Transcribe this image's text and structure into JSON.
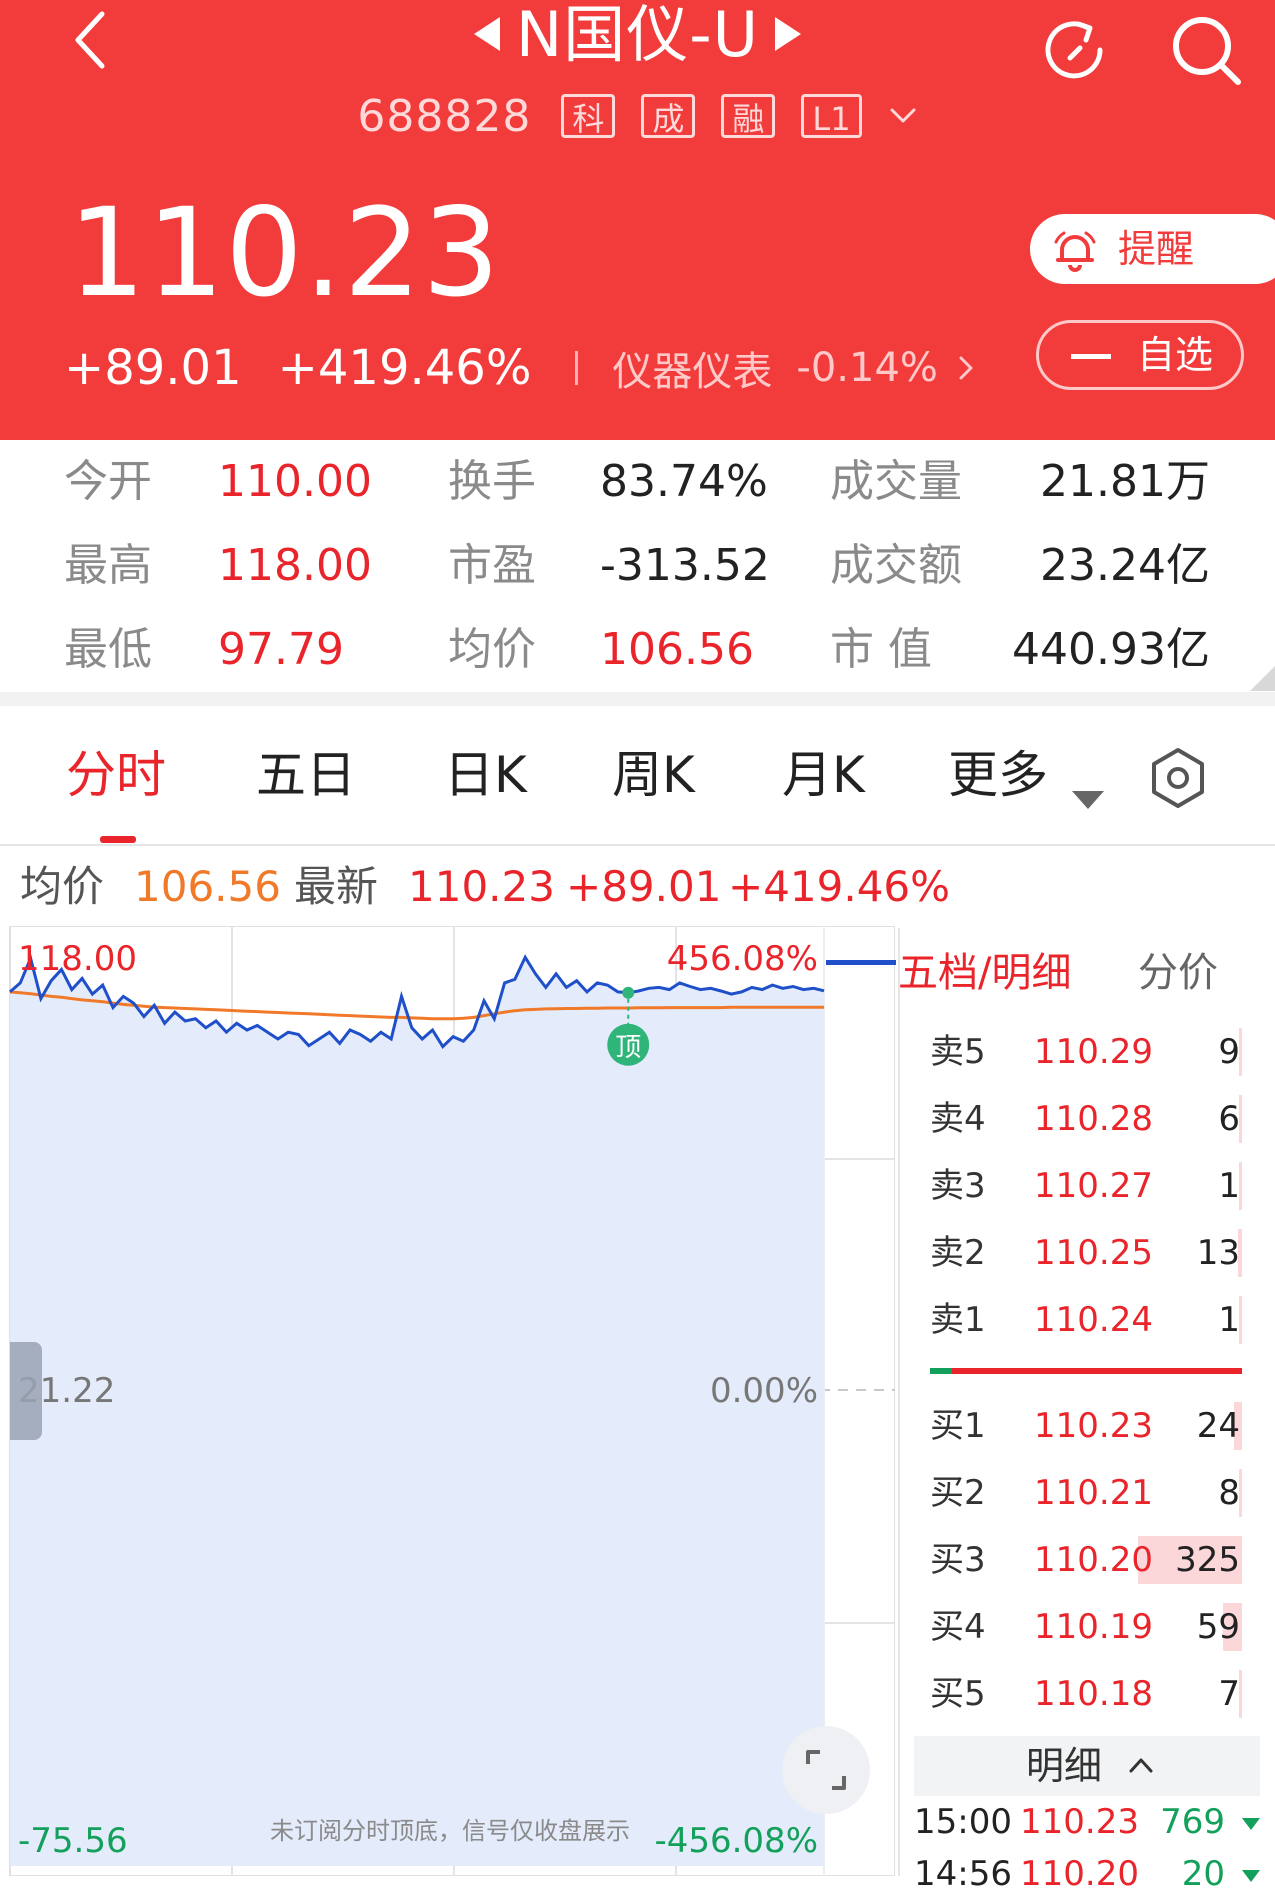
{
  "header": {
    "title": "N国仪-U",
    "code": "688828",
    "badges": [
      "科",
      "成",
      "融",
      "L1"
    ],
    "price": "110.23",
    "change": "+89.01",
    "change_pct": "+419.46%",
    "sector_name": "仪器仪表",
    "sector_change": "-0.14%",
    "alert_label": "提醒",
    "watch_label": "自选"
  },
  "stats": [
    [
      {
        "label": "今开",
        "value": "110.00"
      },
      {
        "label": "换手",
        "value": "83.74%"
      },
      {
        "label": "成交量",
        "value": "21.81万"
      }
    ],
    [
      {
        "label": "最高",
        "value": "118.00"
      },
      {
        "label": "市盈",
        "value": "-313.52"
      },
      {
        "label": "成交额",
        "value": "23.24亿"
      }
    ],
    [
      {
        "label": "最低",
        "value": "97.79"
      },
      {
        "label": "均价",
        "value": "106.56"
      },
      {
        "label": "市 值",
        "value": "440.93亿"
      }
    ]
  ],
  "tabs": [
    "分时",
    "五日",
    "日K",
    "周K",
    "月K",
    "更多"
  ],
  "chart_info": {
    "avg_label": "均价",
    "avg_value": "106.56",
    "latest_label": "最新",
    "latest_value": "110.23",
    "latest_change": "+89.01",
    "latest_pct": "+419.46%"
  },
  "chart_data": {
    "type": "line",
    "y_top_label": "118.00",
    "y_top_pct": "456.08%",
    "y_mid_label": "21.22",
    "y_mid_pct": "0.00%",
    "y_bottom_label": "-75.56",
    "y_bottom_pct": "-456.08%",
    "ylim": [
      -75.56,
      118.0
    ],
    "marker_label": "顶",
    "footnote": "未订阅分时顶底，信号仅收盘展示",
    "series": [
      {
        "key": "price",
        "color": "#1f4fc9",
        "values": [
          110.0,
          112.0,
          117.5,
          108.5,
          112.5,
          115.0,
          110.5,
          113.0,
          109.5,
          111.5,
          106.5,
          109.0,
          107.5,
          104.5,
          107.0,
          103.0,
          105.5,
          103.5,
          104.0,
          102.0,
          103.5,
          101.0,
          103.0,
          101.5,
          102.5,
          101.0,
          99.5,
          101.0,
          100.5,
          98.0,
          99.5,
          101.0,
          98.5,
          101.5,
          100.5,
          99.0,
          101.0,
          99.5,
          109.0,
          102.0,
          99.5,
          101.5,
          97.8,
          100.0,
          99.0,
          101.5,
          108.0,
          104.0,
          112.0,
          112.8,
          117.7,
          114.0,
          111.0,
          114.0,
          111.0,
          112.5,
          110.0,
          112.0,
          111.5,
          110.0,
          109.8,
          110.2,
          110.8,
          111.0,
          110.5,
          112.0,
          111.2,
          110.5,
          110.8,
          110.2,
          109.5,
          110.0,
          111.0,
          110.5,
          111.5,
          110.8,
          111.2,
          110.5,
          110.8,
          110.23
        ]
      },
      {
        "key": "average",
        "color": "#f07a2a",
        "values": [
          110.0,
          109.8,
          109.6,
          109.3,
          109.0,
          108.8,
          108.5,
          108.2,
          108.0,
          107.8,
          107.5,
          107.2,
          107.0,
          106.8,
          106.6,
          106.5,
          106.4,
          106.3,
          106.2,
          106.1,
          106.0,
          105.9,
          105.8,
          105.7,
          105.6,
          105.5,
          105.4,
          105.3,
          105.2,
          105.1,
          105.0,
          104.9,
          104.8,
          104.7,
          104.6,
          104.5,
          104.4,
          104.3,
          104.3,
          104.2,
          104.1,
          104.0,
          104.0,
          104.0,
          104.1,
          104.3,
          104.7,
          105.1,
          105.5,
          105.8,
          106.0,
          106.1,
          106.2,
          106.25,
          106.3,
          106.3,
          106.35,
          106.35,
          106.4,
          106.4,
          106.4,
          106.45,
          106.45,
          106.45,
          106.5,
          106.5,
          106.5,
          106.5,
          106.5,
          106.5,
          106.55,
          106.55,
          106.55,
          106.55,
          106.56,
          106.56,
          106.56,
          106.56,
          106.56,
          106.56
        ]
      }
    ]
  },
  "orderbook": {
    "tab_active": "五档/明细",
    "tab_other": "分价",
    "asks": [
      {
        "label": "卖5",
        "price": "110.29",
        "vol": "9"
      },
      {
        "label": "卖4",
        "price": "110.28",
        "vol": "6"
      },
      {
        "label": "卖3",
        "price": "110.27",
        "vol": "1"
      },
      {
        "label": "卖2",
        "price": "110.25",
        "vol": "13"
      },
      {
        "label": "卖1",
        "price": "110.24",
        "vol": "1"
      }
    ],
    "bids": [
      {
        "label": "买1",
        "price": "110.23",
        "vol": "24"
      },
      {
        "label": "买2",
        "price": "110.21",
        "vol": "8"
      },
      {
        "label": "买3",
        "price": "110.20",
        "vol": "325"
      },
      {
        "label": "买4",
        "price": "110.19",
        "vol": "59"
      },
      {
        "label": "买5",
        "price": "110.18",
        "vol": "7"
      }
    ],
    "detail_label": "明细",
    "trades": [
      {
        "time": "15:00",
        "price": "110.23",
        "vol": "769"
      },
      {
        "time": "14:56",
        "price": "110.20",
        "vol": "20"
      }
    ]
  },
  "colors": {
    "header_red": "#f23b3b",
    "up_red": "#e9242a",
    "down_green": "#12a05a",
    "price_line": "#1f4fc9",
    "avg_line": "#f07a2a",
    "chart_fill": "#e4ebfb"
  }
}
